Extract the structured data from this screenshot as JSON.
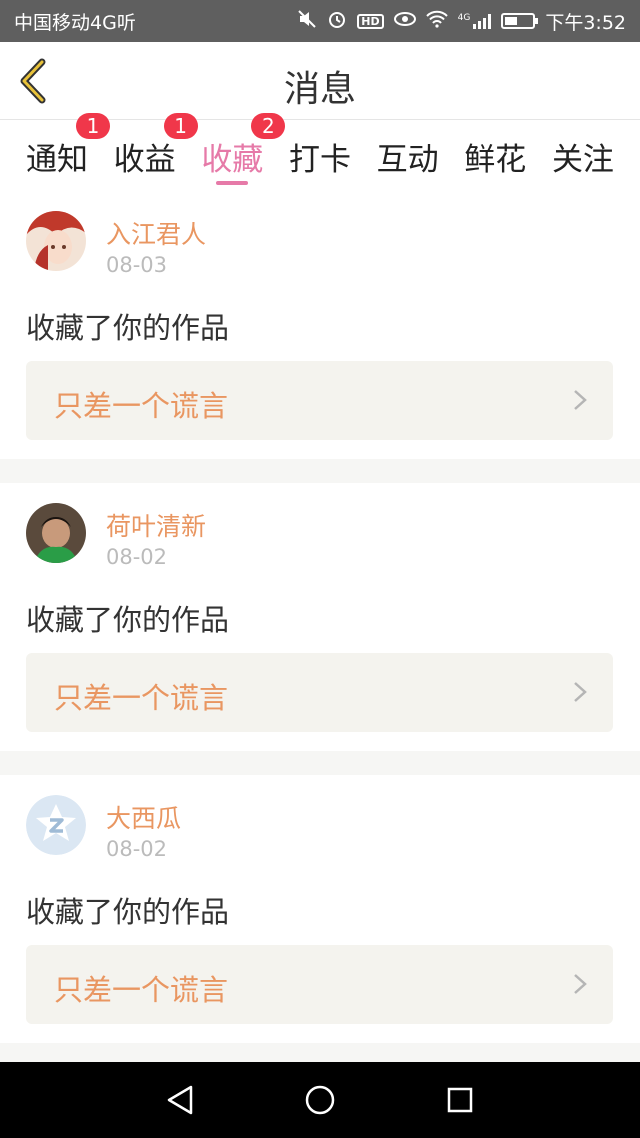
{
  "status_bar": {
    "carrier": "中国移动4G",
    "listen_icon": "听",
    "time": "下午3:52",
    "network_type": "4G",
    "hd_label": "HD",
    "icons": [
      "mute-icon",
      "alarm-icon",
      "hd-icon",
      "eye-icon",
      "wifi-icon",
      "signal-icon",
      "battery-icon"
    ]
  },
  "header": {
    "title": "消息",
    "back_icon": "chevron-left-icon",
    "accent_color": "#e8c23a"
  },
  "tabs": [
    {
      "label": "通知",
      "badge": "1",
      "active": false
    },
    {
      "label": "收益",
      "badge": "1",
      "active": false
    },
    {
      "label": "收藏",
      "badge": "2",
      "active": true
    },
    {
      "label": "打卡",
      "badge": "",
      "active": false
    },
    {
      "label": "互动",
      "badge": "",
      "active": false
    },
    {
      "label": "鲜花",
      "badge": "",
      "active": false
    },
    {
      "label": "关注",
      "badge": "",
      "active": false
    }
  ],
  "items": [
    {
      "user": "入江君人",
      "date": "08-03",
      "action": "收藏了你的作品",
      "work_title": "只差一个谎言"
    },
    {
      "user": "荷叶清新",
      "date": "08-02",
      "action": "收藏了你的作品",
      "work_title": "只差一个谎言"
    },
    {
      "user": "大西瓜",
      "date": "08-02",
      "action": "收藏了你的作品",
      "work_title": "只差一个谎言"
    }
  ],
  "colors": {
    "active_tab": "#e67aa8",
    "badge": "#f0374a",
    "username": "#e99661",
    "work_bg": "#f4f3ee"
  },
  "nav_bar": {
    "icons": [
      "back-triangle-icon",
      "home-circle-icon",
      "recents-square-icon"
    ]
  }
}
